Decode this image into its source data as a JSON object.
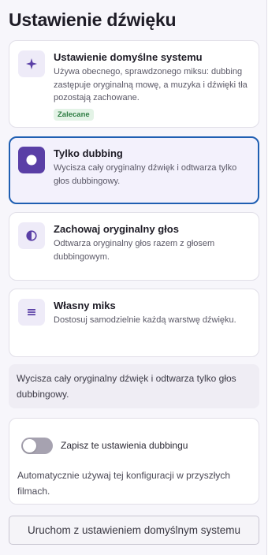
{
  "page": {
    "title": "Ustawienie dźwięku"
  },
  "options": [
    {
      "icon": "sparkle-icon",
      "title": "Ustawienie domyślne systemu",
      "description": "Używa obecnego, sprawdzonego miksu: dubbing zastępuje oryginalną mowę, a muzyka i dźwięki tła pozostają zachowane.",
      "badge": "Zalecane",
      "selected": false
    },
    {
      "icon": "record-icon",
      "title": "Tylko dubbing",
      "description": "Wycisza cały oryginalny dźwięk i odtwarza tylko głos dubbingowy.",
      "selected": true
    },
    {
      "icon": "half-circle-icon",
      "title": "Zachowaj oryginalny głos",
      "description": "Odtwarza oryginalny głos razem z głosem dubbingowym.",
      "selected": false
    },
    {
      "icon": "menu-lines-icon",
      "title": "Własny miks",
      "description": "Dostosuj samodzielnie każdą warstwę dźwięku.",
      "selected": false
    }
  ],
  "info": {
    "text": "Wycisza cały oryginalny dźwięk i odtwarza tylko głos dubbingowy."
  },
  "save": {
    "toggle_on": false,
    "label": "Zapisz te ustawienia dubbingu",
    "description": "Automatycznie używaj tej konfiguracji w przyszłych filmach."
  },
  "actions": {
    "run_label": "Uruchom z ustawieniem domyślnym systemu"
  },
  "colors": {
    "accent": "#5a3fa6",
    "selected_border": "#1f5fb2",
    "badge_bg": "#e3f3e6",
    "badge_text": "#2e7d43"
  }
}
